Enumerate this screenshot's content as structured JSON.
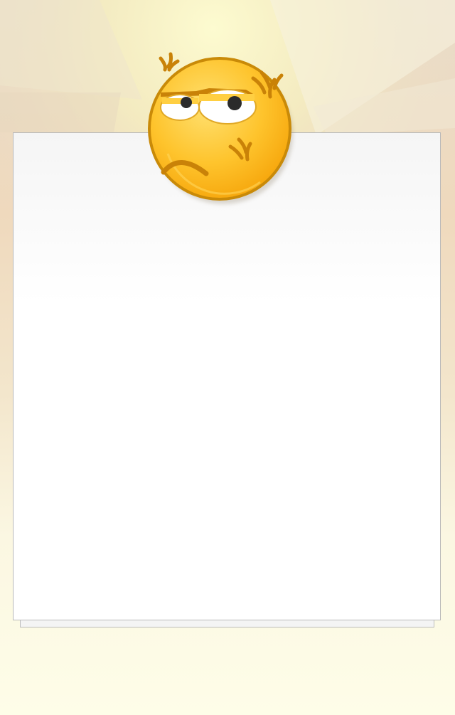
{
  "scene": {
    "icon": "angry-emoji-icon",
    "colors": {
      "face_fill": "#fec42d",
      "face_outline": "#c98a08",
      "anger_mark": "#c98208",
      "background_glow": "#fbf7c0",
      "paper": "#ffffff"
    }
  }
}
